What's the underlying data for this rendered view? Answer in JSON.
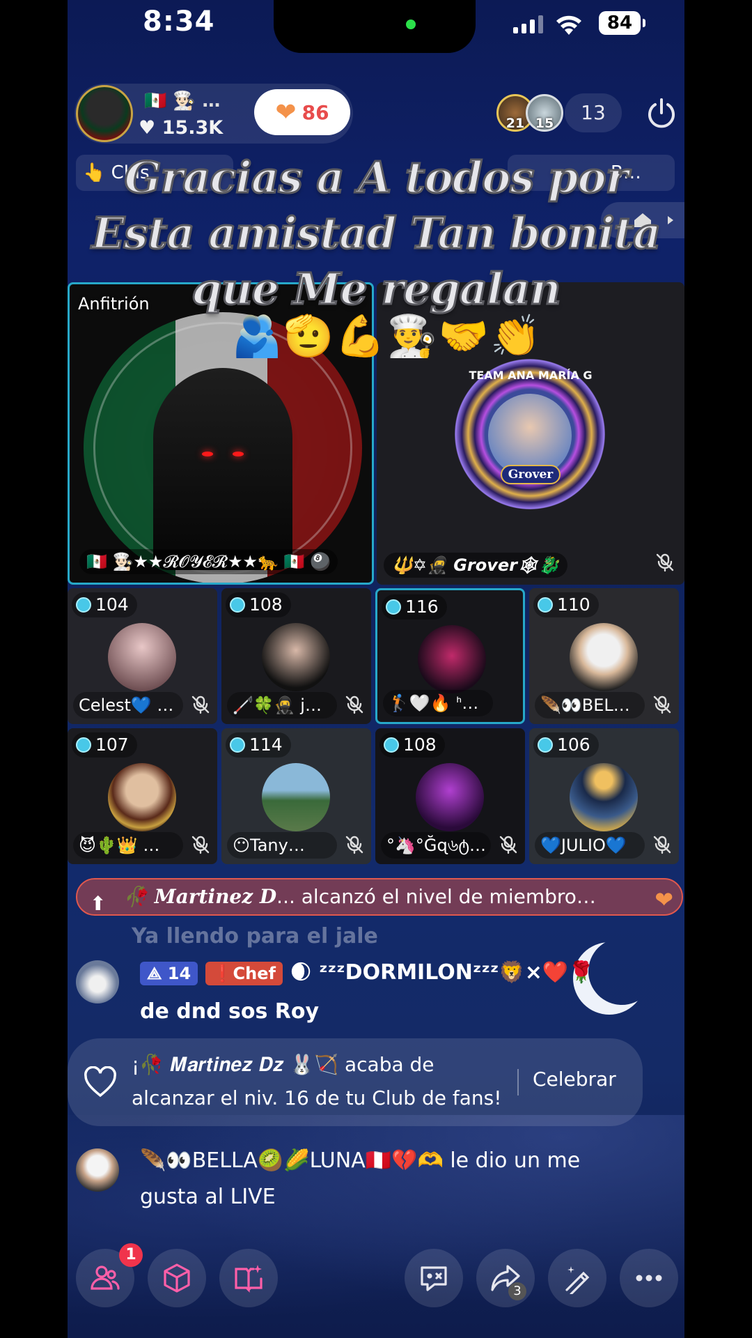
{
  "status_bar": {
    "time": "8:34",
    "battery": "84"
  },
  "host": {
    "emoji_line": "🇲🇽 👨🏻‍🍳",
    "ellipsis": "…",
    "likes": "15.3K",
    "likes_icon": "heart-icon",
    "heart_count": "86"
  },
  "viewers": {
    "avatars": [
      {
        "level": "21"
      },
      {
        "level": "15"
      }
    ],
    "count": "13"
  },
  "pills": {
    "left_label": "👆 Clas",
    "right_label": "B…"
  },
  "caption": {
    "line1": "Gracias a A todos por",
    "line2": "Esta amistad Tan bonita",
    "line3": "que Me regalan",
    "emojis": "🫂🫡💪👨‍🍳🤝👏"
  },
  "host_tile": {
    "role_label": "Anfitrión",
    "name": "🇲🇽 👨🏻‍🍳★★𝓡𝓞𝓨𝓔𝓡★★🐆 🇲🇽 🎱"
  },
  "featured_guest": {
    "badge_title": "TEAM ANA MARÍA G",
    "badge_name": "Grover",
    "name": "🔱✡🥷 Grover🕸🐉"
  },
  "seats": [
    {
      "level": "104",
      "name": "Celest💙 …"
    },
    {
      "level": "108",
      "name": "🦯🍀🥷 j…"
    },
    {
      "level": "116",
      "name": "🏌🤍🔥 ᑋ…"
    },
    {
      "level": "110",
      "name": "🪶👀BEL…"
    },
    {
      "level": "107",
      "name": "😈🌵👑 …"
    },
    {
      "level": "114",
      "name": "😶Tany…"
    },
    {
      "level": "108",
      "name": "°🦄°Ğɋ৬ტ…"
    },
    {
      "level": "106",
      "name": "💙JULIO💙"
    }
  ],
  "announcement": {
    "name": "🥀 𝑴𝒂𝒓𝒕𝒊𝒏𝒆𝒛 𝑫",
    "text": "... alcanzó el nivel de miembro…"
  },
  "chat": {
    "faded": "Ya llendo para el jale",
    "msg1": {
      "level": "14",
      "badge": "Chef",
      "user": "🌒 ᶻᶻᶻDORMILONᶻᶻᶻ🦁×❤️🌹",
      "text": "de dnd sos Roy"
    },
    "fanclub": {
      "line1": "¡🥀 𝑴𝒂𝒓𝒕𝒊𝒏𝒆𝒛 𝑫𝒛 🐰🏹 acaba de",
      "line2": "alcanzar el niv. 16 de tu Club de fans!",
      "button": "Celebrar"
    },
    "msg2": {
      "user": "🪶👀BELLA🥝🌽LUNA🇵🇪💔🫶",
      "line1": " le dio un me",
      "line2": "gusta al LIVE"
    }
  },
  "bottom_bar": {
    "friends_badge": "1",
    "share_count": "3",
    "icons": [
      "friends-icon",
      "cube-icon",
      "book-sparkle-icon",
      "comment-icon",
      "share-icon",
      "magic-wand-icon",
      "more-icon"
    ]
  },
  "colors": {
    "accent_cyan": "#27a8c9",
    "heart_orange": "#f4924a",
    "notif_red": "#f0344c"
  }
}
